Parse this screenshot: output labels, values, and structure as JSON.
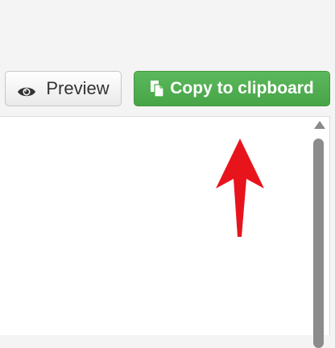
{
  "toolbar": {
    "preview_label": "Preview",
    "copy_label": "Copy to clipboard"
  },
  "colors": {
    "copy_button": "#4cae4c",
    "preview_button": "#f0f0f0",
    "annotation_arrow": "#e8141c",
    "scroll_thumb": "#8c8c8c"
  },
  "icons": {
    "preview": "eye-icon",
    "copy": "copy-icon",
    "scroll": "scroll-up-arrow-icon"
  }
}
